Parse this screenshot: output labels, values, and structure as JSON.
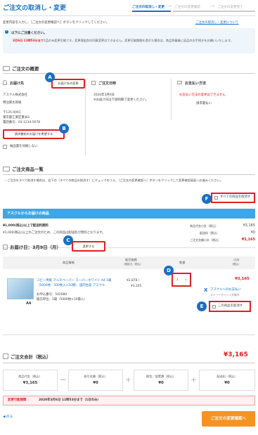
{
  "header": {
    "title": "ご注文の取消し・変更",
    "steps": [
      "ご注文の取消し・変更",
      "ご注文の変更確認",
      "ご注文の変更完了"
    ],
    "arrows": [
      "-->",
      "-->"
    ]
  },
  "intro": {
    "text": "変更内容を入力し、［ご注文の変更確認へ］ボタンをクリックしてください。",
    "cancel_link": "ご注文の取消し・変更について"
  },
  "notice": {
    "icon": "!",
    "title": "以下にご注意ください。",
    "line1_red": "3月6日 11時53分まで",
    "line1_rest": "1品のみ変更可能です。変更理由別の同意変更はできません。変更可能期間を過ぎた場合は、商品到着後に返品のお手続きをお願いいたします。"
  },
  "overview": {
    "title": "ご注文の概要",
    "delivery": {
      "head": "お届け先",
      "change_button": "お届け先の変更",
      "company": "アスクル株式会社",
      "person": "特注東太郎様",
      "postal": "〒135-0061",
      "address": "東京都江東区豊洲3",
      "phone": "電話番号：03-1234-5678",
      "separate_button": "請求書宛のお届けを希望する",
      "checkbox_label": "納品書を同梱しない"
    },
    "date": {
      "head": "ご注文日時",
      "value": "2020年3月6日",
      "note": "※お届け日は下部明細で変更ください。"
    },
    "payment": {
      "head": "お支払い方法",
      "warn": "お支払い方法の変更はできません",
      "method": "請求書払い"
    }
  },
  "items": {
    "title": "ご注文商品一覧",
    "note": "・ご注文をすべて取消す場合は、右下の［すべての商品を取消す］にチェックのうえ、［ご注文の変更確認へ］ボタンをクリックして変更確認画面へお進みください。",
    "cancel_all_label": "すべての商品を取消す",
    "banner": "アスクルからお届けの商品",
    "free_ship": "¥1,000(税込)以上で配送料無料",
    "free_ship_note": "¥1,000(税込)以上のご注文のため、この商品は配送料が無料となります。",
    "sums": [
      {
        "label": "商品代金小計（税込）",
        "value": "¥3,165"
      },
      {
        "label": "配送料（税込）",
        "value": "¥0"
      },
      {
        "label": "ご注文金額小計（税込）",
        "value": "¥3,165"
      }
    ],
    "delivery_day": "お届け日：3月9日（月）",
    "change_day_button": "変更する",
    "cols": {
      "info": "商品情報",
      "price": "販売価格",
      "price_sub": "（税抜き／税込）",
      "qty": "数量",
      "sub": "小計",
      "sub_sub": "（税込）"
    },
    "product": {
      "name": "コピー用紙 マルチペーパー スーパーホワイト A4 1箱（5000枚：500枚入×10冊） 国内生産 アスクル",
      "code": "お申込番号：542680",
      "unit": "販売単位：1箱（5000枚×10冊入）",
      "thumb": "A4",
      "price_ex": "¥2,878 /",
      "price_in": "¥3,165",
      "qty": "1",
      "qty_arrow": "v",
      "subtotal": "¥3,165",
      "pay_note": "アスクルへのお支払い",
      "points": "スイートポイント対象外",
      "cancel_label": "この商品を取消す"
    }
  },
  "total": {
    "title": "ご注文合計（税込）",
    "value": "¥3,165",
    "boxes": [
      {
        "label": "商品代金（税込）",
        "value": "¥3,165"
      },
      {
        "label": "修引金額（税込）",
        "value": "¥0"
      },
      {
        "label": "梱包／設置費（税込）",
        "value": "¥0"
      },
      {
        "label": "配送料（税込）",
        "value": "¥0"
      }
    ],
    "ops": [
      "ー",
      "＋",
      "＋"
    ],
    "deadline_label": "変更可能期間",
    "deadline_value": "2020年3月6日 11時53分まで（1日のみ）"
  },
  "footer": {
    "back": "◀ 戻る",
    "confirm": "ご注文の変更確認へ"
  },
  "markers": [
    "A",
    "B",
    "C",
    "D",
    "E",
    "F"
  ]
}
